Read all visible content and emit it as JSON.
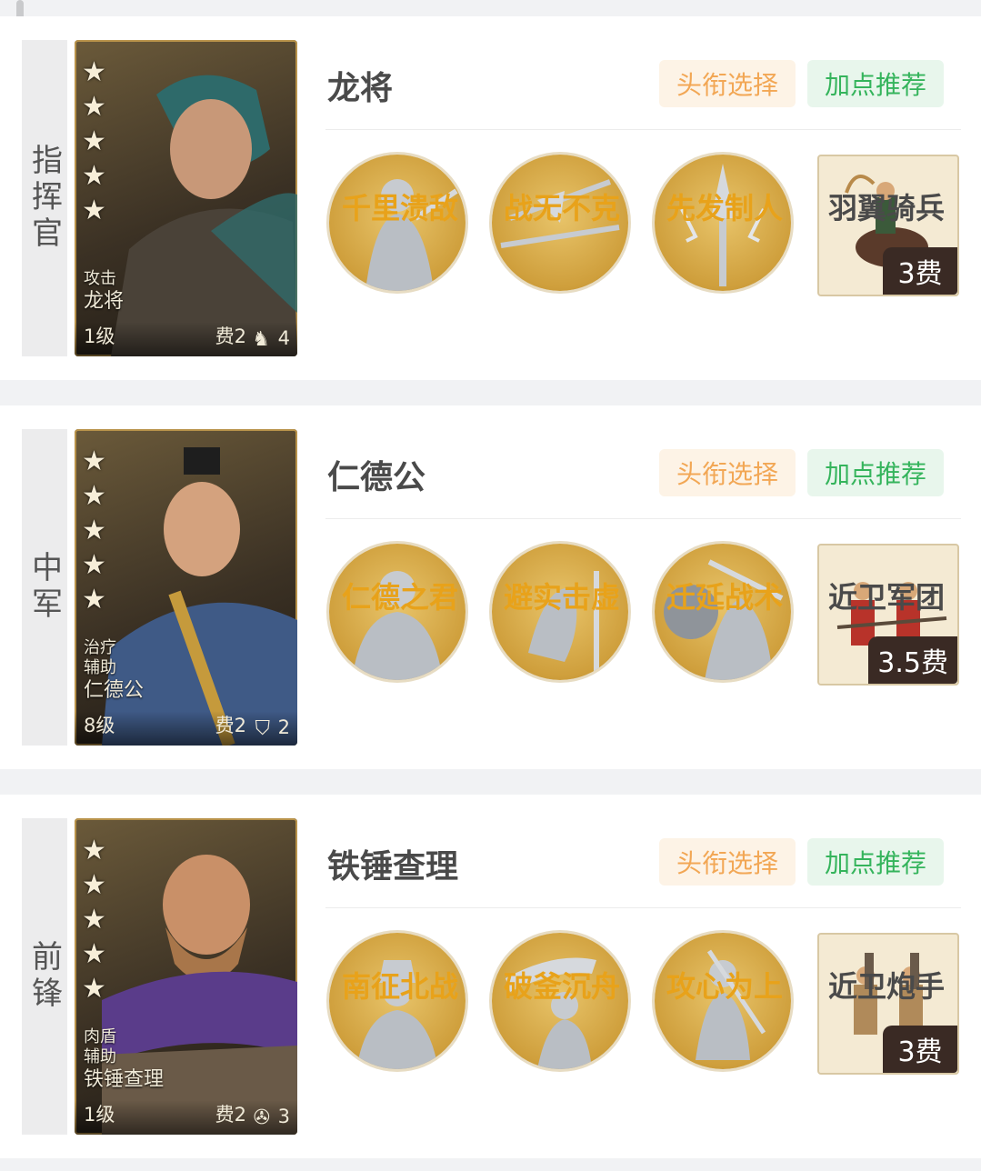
{
  "buttons": {
    "title_select": "头衔选择",
    "points_recommend": "加点推荐"
  },
  "cards": [
    {
      "role": "指挥官",
      "general_name": "龙将",
      "portrait": {
        "stars": 5,
        "tags": [
          "攻击"
        ],
        "name": "龙将",
        "level": "1级",
        "cost": "费2",
        "type_icon": "cavalry-icon",
        "type_count": "4"
      },
      "skills": [
        "千里溃敌",
        "战无不克",
        "先发制人"
      ],
      "unit": {
        "name": "羽翼骑兵",
        "cost": "3费"
      }
    },
    {
      "role": "中军",
      "general_name": "仁德公",
      "portrait": {
        "stars": 5,
        "tags": [
          "治疗",
          "辅助"
        ],
        "name": "仁德公",
        "level": "8级",
        "cost": "费2",
        "type_icon": "shield-icon",
        "type_count": "2"
      },
      "skills": [
        "仁德之君",
        "避实击虚",
        "迁延战术"
      ],
      "unit": {
        "name": "近卫军团",
        "cost": "3.5费"
      }
    },
    {
      "role": "前锋",
      "general_name": "铁锤查理",
      "portrait": {
        "stars": 5,
        "tags": [
          "肉盾",
          "辅助"
        ],
        "name": "铁锤查理",
        "level": "1级",
        "cost": "费2",
        "type_icon": "cannon-icon",
        "type_count": "3"
      },
      "skills": [
        "南征北战",
        "破釜沉舟",
        "攻心为上"
      ],
      "unit": {
        "name": "近卫炮手",
        "cost": "3费"
      }
    }
  ],
  "colors": {
    "skill_text": "#e8a21a",
    "title_btn": "#f2a755",
    "points_btn": "#35b45c",
    "unit_cost_bg": "#3a2a24"
  }
}
